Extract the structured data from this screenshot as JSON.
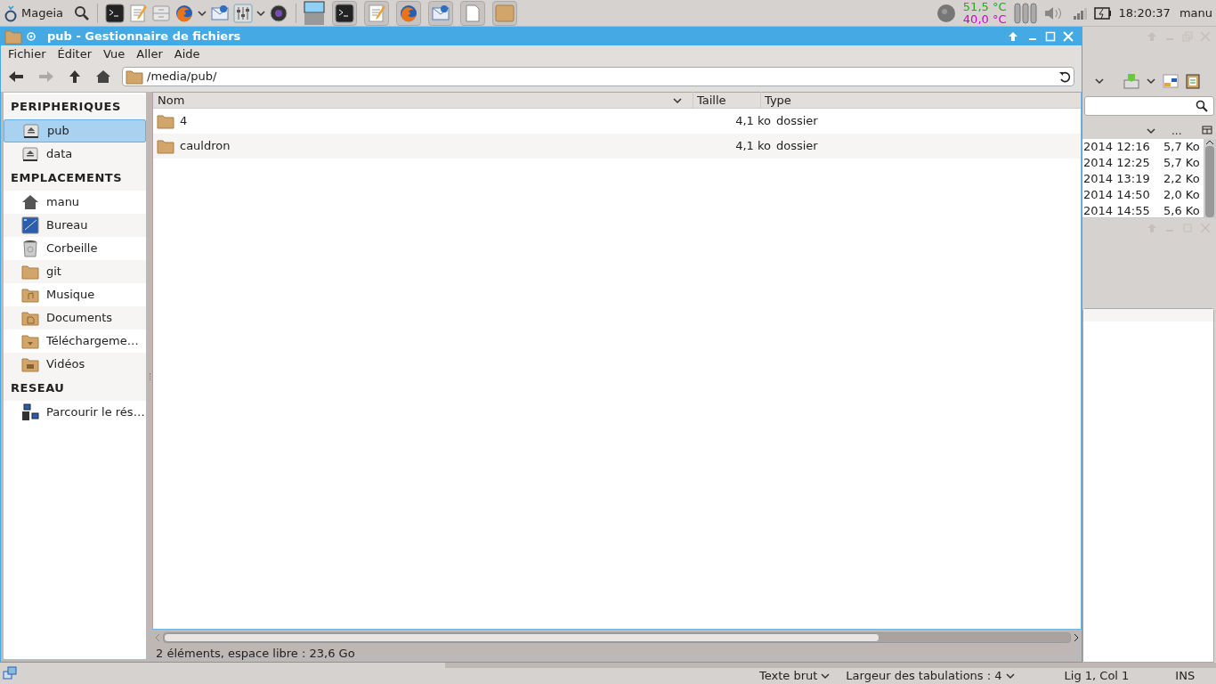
{
  "top_panel": {
    "menu_label": "Mageia",
    "temperatures": [
      {
        "text": "51,5 °C",
        "color": "#22aa22"
      },
      {
        "text": "40,0 °C",
        "color": "#cc00cc"
      }
    ],
    "clock": "18:20:37",
    "user": "manu"
  },
  "window": {
    "title": "pub - Gestionnaire de fichiers",
    "menus": [
      "Fichier",
      "Éditer",
      "Vue",
      "Aller",
      "Aide"
    ],
    "location": "/media/pub/",
    "sidebar": [
      {
        "title": "PERIPHERIQUES",
        "items": [
          {
            "label": "pub",
            "kind": "drive",
            "selected": true
          },
          {
            "label": "data",
            "kind": "drive",
            "selected": false
          }
        ]
      },
      {
        "title": "EMPLACEMENTS",
        "items": [
          {
            "label": "manu",
            "kind": "home",
            "selected": false
          },
          {
            "label": "Bureau",
            "kind": "desktop",
            "selected": false
          },
          {
            "label": "Corbeille",
            "kind": "trash",
            "selected": false
          },
          {
            "label": "git",
            "kind": "folder",
            "selected": false
          },
          {
            "label": "Musique",
            "kind": "music",
            "selected": false
          },
          {
            "label": "Documents",
            "kind": "documents",
            "selected": false
          },
          {
            "label": "Téléchargeme…",
            "kind": "downloads",
            "selected": false
          },
          {
            "label": "Vidéos",
            "kind": "videos",
            "selected": false
          }
        ]
      },
      {
        "title": "RESEAU",
        "items": [
          {
            "label": "Parcourir le rés…",
            "kind": "network",
            "selected": false
          }
        ]
      }
    ],
    "file_list": {
      "columns": [
        "Nom",
        "Taille",
        "Type"
      ],
      "rows": [
        {
          "name": "4",
          "size": "4,1 ko",
          "type": "dossier"
        },
        {
          "name": "cauldron",
          "size": "4,1 ko",
          "type": "dossier"
        }
      ]
    },
    "status_bar": "2 éléments, espace libre : 23,6 Go"
  },
  "background_window": {
    "column_label": "...",
    "rows": [
      {
        "date": "2014 12:16",
        "size": "5,7 Ko"
      },
      {
        "date": "2014 12:25",
        "size": "5,7 Ko"
      },
      {
        "date": "2014 13:19",
        "size": "2,2 Ko"
      },
      {
        "date": "2014 14:50",
        "size": "2,0 Ko"
      },
      {
        "date": "2014 14:55",
        "size": "5,6 Ko"
      }
    ],
    "status_bar": {
      "syntax": "Texte brut",
      "tab_width": "Largeur des tabulations : 4",
      "position": "Lig 1, Col 1",
      "mode": "INS"
    }
  }
}
